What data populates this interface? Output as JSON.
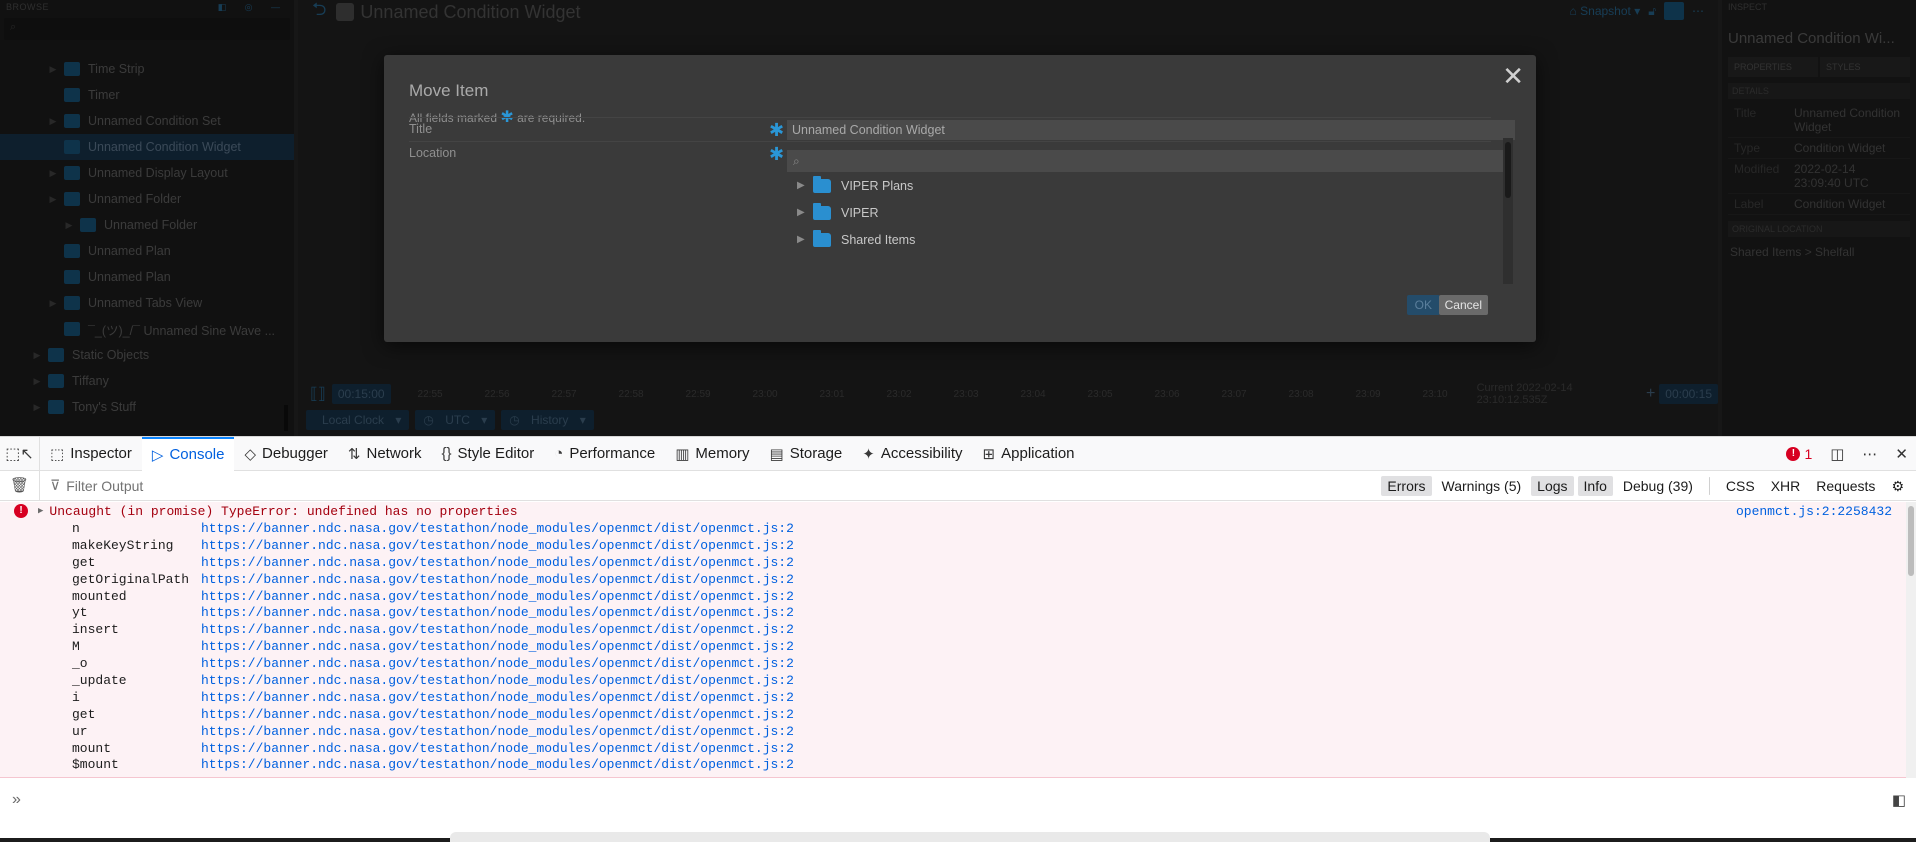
{
  "app": {
    "browse_label": "Browse",
    "inspect_label": "Inspect",
    "tree": [
      {
        "label": "Time Strip",
        "indent": 1,
        "arrow": true,
        "selected": false
      },
      {
        "label": "Timer",
        "indent": 1,
        "arrow": false,
        "selected": false
      },
      {
        "label": "Unnamed Condition Set",
        "indent": 1,
        "arrow": true,
        "selected": false
      },
      {
        "label": "Unnamed Condition Widget",
        "indent": 1,
        "arrow": false,
        "selected": true
      },
      {
        "label": "Unnamed Display Layout",
        "indent": 1,
        "arrow": true,
        "selected": false
      },
      {
        "label": "Unnamed Folder",
        "indent": 1,
        "arrow": true,
        "selected": false
      },
      {
        "label": "Unnamed Folder",
        "indent": 2,
        "arrow": true,
        "selected": false
      },
      {
        "label": "Unnamed Plan",
        "indent": 1,
        "arrow": false,
        "selected": false
      },
      {
        "label": "Unnamed Plan",
        "indent": 1,
        "arrow": false,
        "selected": false
      },
      {
        "label": "Unnamed Tabs View",
        "indent": 1,
        "arrow": true,
        "selected": false
      },
      {
        "label": "¯_(ツ)_/¯ Unnamed Sine Wave ...",
        "indent": 1,
        "arrow": false,
        "selected": false
      },
      {
        "label": "Static Objects",
        "indent": 0,
        "arrow": true,
        "selected": false
      },
      {
        "label": "Tiffany",
        "indent": 0,
        "arrow": true,
        "selected": false
      },
      {
        "label": "Tony's Stuff",
        "indent": 0,
        "arrow": true,
        "selected": false
      }
    ],
    "main_title": "Unnamed Condition Widget",
    "snapshot_label": "Snapshot",
    "time": {
      "start": "00:15:00",
      "end": "00:00:15",
      "ticks": [
        "22:55",
        "22:56",
        "22:57",
        "22:58",
        "22:59",
        "23:00",
        "23:01",
        "23:02",
        "23:03",
        "23:04",
        "23:05",
        "23:06",
        "23:07",
        "23:08",
        "23:09",
        "23:10"
      ],
      "current": "Current  2022-02-14 23:10:12.535Z",
      "clock": "Local Clock",
      "timezone": "UTC",
      "history": "History"
    },
    "inspector": {
      "title": "Unnamed Condition Wi...",
      "tabs": [
        "Properties",
        "Styles"
      ],
      "details_label": "Details",
      "props": [
        {
          "k": "Title",
          "v": "Unnamed Condition Widget"
        },
        {
          "k": "Type",
          "v": "Condition Widget"
        },
        {
          "k": "Modified",
          "v": "2022-02-14 23:09:40 UTC"
        },
        {
          "k": "Label",
          "v": "Condition Widget"
        }
      ],
      "orig_loc_label": "Original Location",
      "orig_loc": "Shared Items  >  Shelfall"
    }
  },
  "modal": {
    "title": "Move Item",
    "required_prefix": "All fields marked",
    "required_suffix": "are required.",
    "title_label": "Title",
    "title_value": "Unnamed Condition Widget",
    "location_label": "Location",
    "search_placeholder": "",
    "folders": [
      "VIPER Plans",
      "VIPER",
      "Shared Items"
    ],
    "ok_label": "OK",
    "cancel_label": "Cancel"
  },
  "devtools": {
    "tabs": [
      {
        "label": "Inspector",
        "icon": "inspector-icon",
        "glyph": "⬚"
      },
      {
        "label": "Console",
        "icon": "console-icon",
        "glyph": "▷",
        "active": true
      },
      {
        "label": "Debugger",
        "icon": "debugger-icon",
        "glyph": "◇"
      },
      {
        "label": "Network",
        "icon": "network-icon",
        "glyph": "⇅"
      },
      {
        "label": "Style Editor",
        "icon": "style-editor-icon",
        "glyph": "{}"
      },
      {
        "label": "Performance",
        "icon": "performance-icon",
        "glyph": "◔"
      },
      {
        "label": "Memory",
        "icon": "memory-icon",
        "glyph": "▥"
      },
      {
        "label": "Storage",
        "icon": "storage-icon",
        "glyph": "▤"
      },
      {
        "label": "Accessibility",
        "icon": "accessibility-icon",
        "glyph": "✦"
      },
      {
        "label": "Application",
        "icon": "application-icon",
        "glyph": "⊞"
      }
    ],
    "error_count": "1",
    "filter_placeholder": "Filter Output",
    "filters": [
      {
        "label": "Errors",
        "on": true
      },
      {
        "label": "Warnings (5)",
        "on": false
      },
      {
        "label": "Logs",
        "on": true
      },
      {
        "label": "Info",
        "on": true
      },
      {
        "label": "Debug (39)",
        "on": false
      }
    ],
    "net_filters": [
      "CSS",
      "XHR",
      "Requests"
    ],
    "error_message": "Uncaught (in promise) TypeError: undefined has no properties",
    "error_source": "openmct.js:2:2258432",
    "frames": [
      {
        "fn": "n",
        "url": "https://banner.ndc.nasa.gov/testathon/node_modules/openmct/dist/openmct.js:2"
      },
      {
        "fn": "makeKeyString",
        "url": "https://banner.ndc.nasa.gov/testathon/node_modules/openmct/dist/openmct.js:2"
      },
      {
        "fn": "get",
        "url": "https://banner.ndc.nasa.gov/testathon/node_modules/openmct/dist/openmct.js:2"
      },
      {
        "fn": "getOriginalPath",
        "url": "https://banner.ndc.nasa.gov/testathon/node_modules/openmct/dist/openmct.js:2"
      },
      {
        "fn": "mounted",
        "url": "https://banner.ndc.nasa.gov/testathon/node_modules/openmct/dist/openmct.js:2"
      },
      {
        "fn": "yt",
        "url": "https://banner.ndc.nasa.gov/testathon/node_modules/openmct/dist/openmct.js:2"
      },
      {
        "fn": "insert",
        "url": "https://banner.ndc.nasa.gov/testathon/node_modules/openmct/dist/openmct.js:2"
      },
      {
        "fn": "M",
        "url": "https://banner.ndc.nasa.gov/testathon/node_modules/openmct/dist/openmct.js:2"
      },
      {
        "fn": "_o",
        "url": "https://banner.ndc.nasa.gov/testathon/node_modules/openmct/dist/openmct.js:2"
      },
      {
        "fn": "_update",
        "url": "https://banner.ndc.nasa.gov/testathon/node_modules/openmct/dist/openmct.js:2"
      },
      {
        "fn": "i",
        "url": "https://banner.ndc.nasa.gov/testathon/node_modules/openmct/dist/openmct.js:2"
      },
      {
        "fn": "get",
        "url": "https://banner.ndc.nasa.gov/testathon/node_modules/openmct/dist/openmct.js:2"
      },
      {
        "fn": "ur",
        "url": "https://banner.ndc.nasa.gov/testathon/node_modules/openmct/dist/openmct.js:2"
      },
      {
        "fn": "mount",
        "url": "https://banner.ndc.nasa.gov/testathon/node_modules/openmct/dist/openmct.js:2"
      },
      {
        "fn": "$mount",
        "url": "https://banner.ndc.nasa.gov/testathon/node_modules/openmct/dist/openmct.js:2"
      }
    ],
    "prompt_glyph": "»"
  }
}
